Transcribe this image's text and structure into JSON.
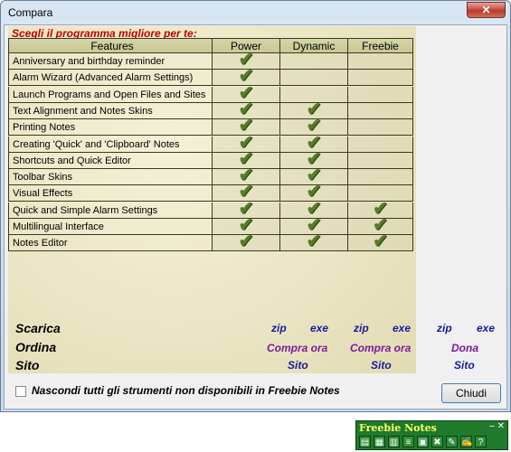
{
  "window": {
    "title": "Compara",
    "close_label": "✕"
  },
  "heading": "Scegli il programma migliore per te:",
  "table": {
    "columns": [
      "Features",
      "Power",
      "Dynamic",
      "Freebie"
    ],
    "rows": [
      {
        "feature": "Anniversary and birthday reminder",
        "power": true,
        "dynamic": false,
        "freebie": false
      },
      {
        "feature": "Alarm Wizard (Advanced Alarm Settings)",
        "power": true,
        "dynamic": false,
        "freebie": false
      },
      {
        "feature": "Launch Programs and Open Files and Sites",
        "power": true,
        "dynamic": false,
        "freebie": false
      },
      {
        "feature": "Text Alignment and Notes Skins",
        "power": true,
        "dynamic": true,
        "freebie": false
      },
      {
        "feature": "Printing Notes",
        "power": true,
        "dynamic": true,
        "freebie": false
      },
      {
        "feature": "Creating 'Quick' and 'Clipboard' Notes",
        "power": true,
        "dynamic": true,
        "freebie": false
      },
      {
        "feature": "Shortcuts and Quick Editor",
        "power": true,
        "dynamic": true,
        "freebie": false
      },
      {
        "feature": "Toolbar Skins",
        "power": true,
        "dynamic": true,
        "freebie": false
      },
      {
        "feature": "Visual Effects",
        "power": true,
        "dynamic": true,
        "freebie": false
      },
      {
        "feature": "Quick and Simple Alarm Settings",
        "power": true,
        "dynamic": true,
        "freebie": true
      },
      {
        "feature": "Multilingual Interface",
        "power": true,
        "dynamic": true,
        "freebie": true
      },
      {
        "feature": "Notes Editor",
        "power": true,
        "dynamic": true,
        "freebie": true
      }
    ],
    "check_glyph": "✔"
  },
  "downloads": {
    "label": "Scarica",
    "links": [
      "zip",
      "exe",
      "zip",
      "exe",
      "zip",
      "exe"
    ]
  },
  "order": {
    "label": "Ordina",
    "links": [
      "Compra ora",
      "Compra ora",
      "Dona"
    ]
  },
  "site": {
    "label": "Sito",
    "links": [
      "Sito",
      "Sito",
      "Sito"
    ]
  },
  "hide_option": {
    "label": "Nascondi tutti gli strumenti non disponibili in Freebie Notes",
    "checked": false
  },
  "close_button": "Chiudi",
  "tray": {
    "title": "Freebie Notes",
    "controls": "– ✕",
    "icons": [
      "note-icon",
      "tile-icon",
      "stickies-icon",
      "list-icon",
      "calendar-icon",
      "delete-icon",
      "pen-icon",
      "edit-icon",
      "help-icon"
    ],
    "glyphs": [
      "▤",
      "▦",
      "▥",
      "≡",
      "▣",
      "✖",
      "✎",
      "✍",
      "?"
    ]
  }
}
